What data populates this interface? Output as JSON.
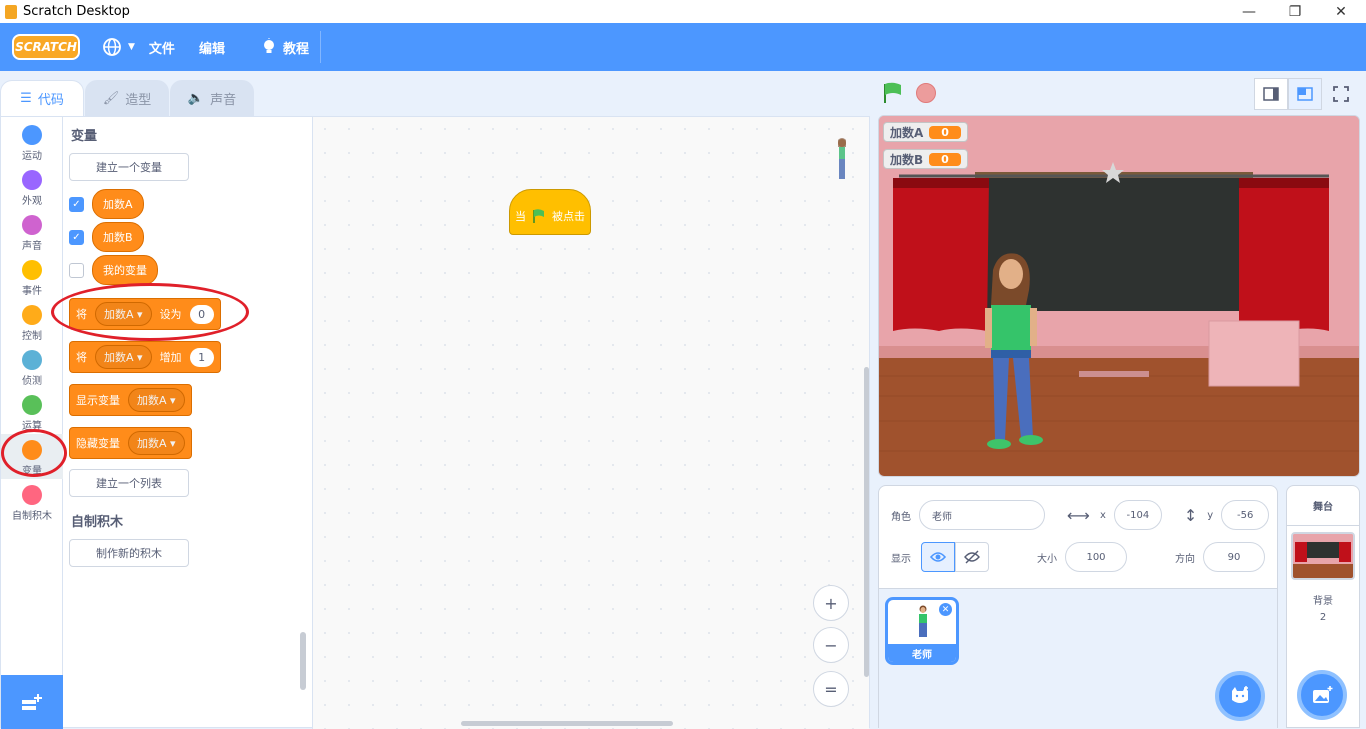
{
  "window": {
    "title": "Scratch Desktop",
    "min": "—",
    "max": "❐",
    "close": "✕"
  },
  "menubar": {
    "logo": "SCRATCH",
    "language_icon": "globe-icon",
    "file": "文件",
    "edit": "编辑",
    "tutorials": "教程",
    "colors": {
      "bar": "#4c97ff"
    }
  },
  "tabs": [
    {
      "label": "代码",
      "icon": "code-icon"
    },
    {
      "label": "造型",
      "icon": "brush-icon"
    },
    {
      "label": "声音",
      "icon": "speaker-icon"
    }
  ],
  "categories": [
    {
      "label": "运动",
      "color": "#4c97ff"
    },
    {
      "label": "外观",
      "color": "#9966ff"
    },
    {
      "label": "声音",
      "color": "#cf63cf"
    },
    {
      "label": "事件",
      "color": "#ffbf00"
    },
    {
      "label": "控制",
      "color": "#ffab19"
    },
    {
      "label": "侦测",
      "color": "#5cb1d6"
    },
    {
      "label": "运算",
      "color": "#59c059"
    },
    {
      "label": "变量",
      "color": "#ff8c1a"
    },
    {
      "label": "自制积木",
      "color": "#ff6680"
    }
  ],
  "palette": {
    "variables_heading": "变量",
    "make_variable": "建立一个变量",
    "variables": [
      {
        "name": "加数A",
        "checked": true
      },
      {
        "name": "加数B",
        "checked": true
      },
      {
        "name": "我的变量",
        "checked": false
      }
    ],
    "set_block": {
      "prefix": "将",
      "var": "加数A",
      "mid": "设为",
      "value": "0"
    },
    "change_block": {
      "prefix": "将",
      "var": "加数A",
      "mid": "增加",
      "value": "1"
    },
    "show_block": {
      "label": "显示变量",
      "var": "加数A"
    },
    "hide_block": {
      "label": "隐藏变量",
      "var": "加数A"
    },
    "make_list": "建立一个列表",
    "my_blocks_heading": "自制积木",
    "make_block": "制作新的积木"
  },
  "script": {
    "hat_prefix": "当",
    "hat_suffix": "被点击"
  },
  "zoom": {
    "in": "+",
    "out": "−",
    "reset": "="
  },
  "stage": {
    "monitors": [
      {
        "label": "加数A",
        "value": "0"
      },
      {
        "label": "加数B",
        "value": "0"
      }
    ]
  },
  "sprite_info": {
    "sprite_label": "角色",
    "sprite_name": "老师",
    "x_label": "x",
    "x": "-104",
    "y_label": "y",
    "y": "-56",
    "show_label": "显示",
    "size_label": "大小",
    "size": "100",
    "direction_label": "方向",
    "direction": "90"
  },
  "sprites": [
    {
      "name": "老师"
    }
  ],
  "stage_panel": {
    "title": "舞台",
    "backdrops_label": "背景",
    "backdrops_count": "2"
  }
}
